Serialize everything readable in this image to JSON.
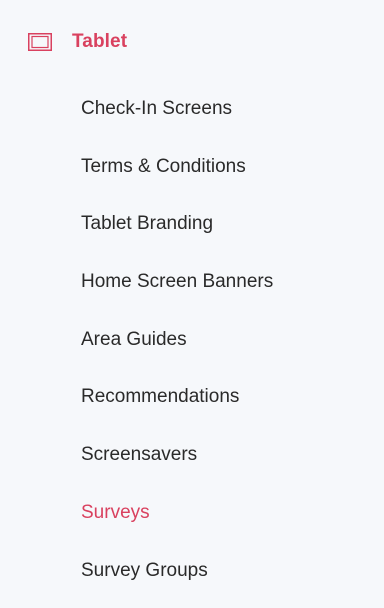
{
  "section": {
    "title": "Tablet",
    "icon": "tablet-icon",
    "accent_color": "#d9415f"
  },
  "menu": {
    "items": [
      {
        "label": "Check-In Screens",
        "active": false
      },
      {
        "label": "Terms & Conditions",
        "active": false
      },
      {
        "label": "Tablet Branding",
        "active": false
      },
      {
        "label": "Home Screen Banners",
        "active": false
      },
      {
        "label": "Area Guides",
        "active": false
      },
      {
        "label": "Recommendations",
        "active": false
      },
      {
        "label": "Screensavers",
        "active": false
      },
      {
        "label": "Surveys",
        "active": true
      },
      {
        "label": "Survey Groups",
        "active": false
      }
    ]
  }
}
